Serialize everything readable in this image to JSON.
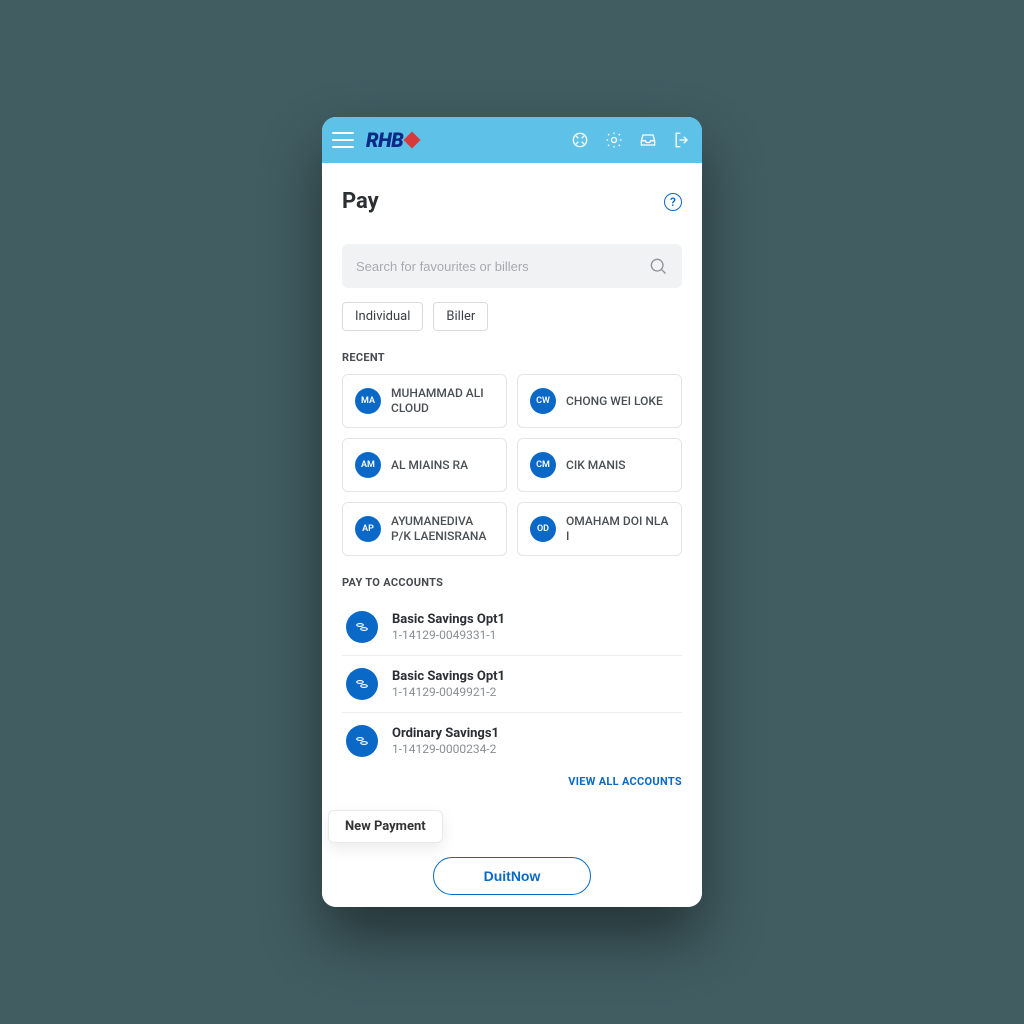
{
  "brand": "RHB",
  "header": {
    "title": "Pay"
  },
  "search": {
    "placeholder": "Search for favourites or billers"
  },
  "filters": {
    "individual": "Individual",
    "biller": "Biller"
  },
  "sections": {
    "recent": "RECENT",
    "pay_to_accounts": "PAY TO ACCOUNTS"
  },
  "recent": [
    {
      "initials": "MA",
      "name": "MUHAMMAD ALI CLOUD"
    },
    {
      "initials": "CW",
      "name": "CHONG WEI LOKE"
    },
    {
      "initials": "AM",
      "name": "AL MIAINS RA"
    },
    {
      "initials": "CM",
      "name": "CIK MANIS"
    },
    {
      "initials": "AP",
      "name": "AYUMANEDIVA P/K LAENISRANA"
    },
    {
      "initials": "OD",
      "name": "OMAHAM DOI NLA I"
    }
  ],
  "accounts": [
    {
      "name": "Basic Savings Opt1",
      "number": "1-14129-0049331-1"
    },
    {
      "name": "Basic Savings Opt1",
      "number": "1-14129-0049921-2"
    },
    {
      "name": "Ordinary Savings1",
      "number": "1-14129-0000234-2"
    }
  ],
  "actions": {
    "view_all": "VIEW ALL ACCOUNTS",
    "new_payment": "New Payment",
    "duitnow": "DuitNow"
  }
}
